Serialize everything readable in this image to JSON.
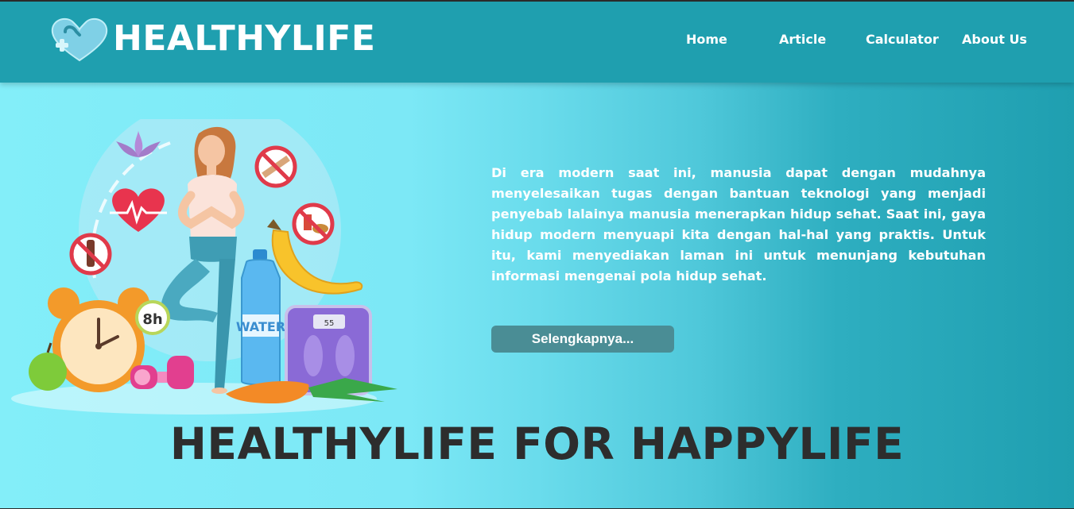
{
  "brand": {
    "name": "HEALTHYLIFE",
    "logo_icon": "heart-plus-logo-icon"
  },
  "nav": {
    "items": [
      {
        "label": "Home"
      },
      {
        "label": "Article"
      },
      {
        "label": "Calculator"
      },
      {
        "label": "About Us"
      }
    ]
  },
  "hero": {
    "description": "Di era modern saat ini, manusia dapat dengan mudahnya menyelesaikan tugas dengan bantuan teknologi yang menjadi penyebab lalainya manusia menerapkan hidup sehat. Saat ini, gaya hidup modern menyuapi kita dengan hal-hal yang praktis. Untuk itu, kami menyediakan laman ini untuk menunjang kebutuhan informasi mengenai pola hidup sehat.",
    "cta_label": "Selengkapnya...",
    "tagline": "HEALTHYLIFE FOR HAPPYLIFE",
    "illustration": {
      "clock_label": "8h",
      "bottle_label": "WATER",
      "scale_label": "55"
    }
  },
  "colors": {
    "navbar": "#1f9faf",
    "hero_left": "#83eef9",
    "hero_right": "#1f9fb0",
    "button": "#4a8d95",
    "tagline": "#2d2d2d"
  }
}
